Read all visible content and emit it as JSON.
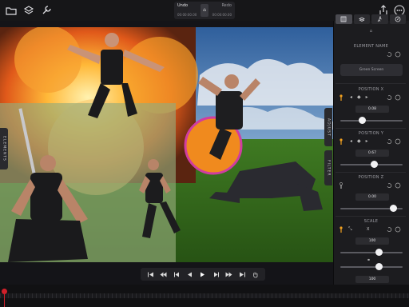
{
  "toolbar": {
    "undo_label": "Undo",
    "redo_label": "Redo",
    "undo_time": "00:00:00.00",
    "redo_time": "00:00:00.00",
    "left_icons": [
      "folder-icon",
      "layers-edit-icon",
      "wrench-icon"
    ],
    "right_icons": [
      "share-icon",
      "more-icon"
    ]
  },
  "side_tabs": {
    "elements": "ELEMENTS",
    "adjust": "ADJUST",
    "filter": "FILTER"
  },
  "panel": {
    "tabs": [
      "film-icon",
      "layers-icon",
      "run-icon",
      "compass-icon"
    ],
    "element_name": {
      "title": "ELEMENT NAME",
      "value": "Green Screen"
    },
    "position_x": {
      "title": "POSITION X",
      "value": "0.08",
      "fraction": 0.35
    },
    "position_y": {
      "title": "POSITION Y",
      "value": "0.67",
      "fraction": 0.55
    },
    "position_z": {
      "title": "POSITION Z",
      "value": "0.00",
      "fraction": 0.85
    },
    "scale": {
      "title": "SCALE",
      "axis_label": "X",
      "value_x": "100",
      "value_y": "100",
      "fraction_x": 0.62,
      "fraction_y": 0.62
    }
  },
  "transport": {
    "buttons": [
      "skip-to-start-icon",
      "rewind-icon",
      "step-back-icon",
      "play-back-icon",
      "play-icon",
      "step-forward-icon",
      "fast-forward-icon",
      "skip-to-end-icon",
      "hand-icon"
    ]
  },
  "colors": {
    "accent_orange": "#f08a1e",
    "accent_magenta": "#d03ca0",
    "playhead": "#d0202a"
  }
}
